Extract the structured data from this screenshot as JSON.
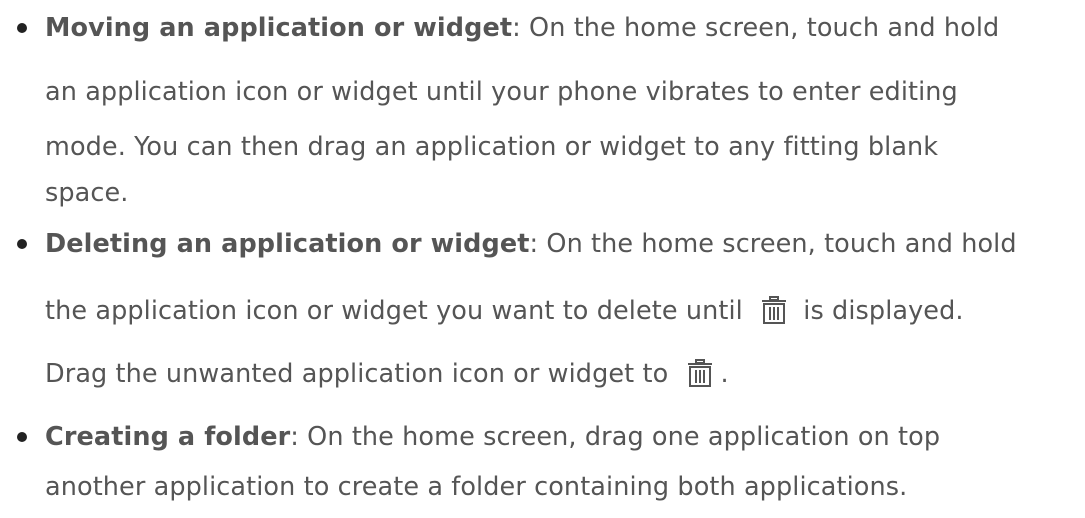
{
  "items": [
    {
      "term": "Moving an application or widget",
      "line1_rest": ": On the home screen, touch and hold",
      "line2": "an application icon or widget until your phone vibrates to enter editing",
      "line3": "mode. You can then drag an application or widget to any fitting blank",
      "line4": "space."
    },
    {
      "term": "Deleting an application or widget",
      "line1_rest": ": On the home screen, touch and hold",
      "line2_before": "the application icon or widget you want to delete until",
      "line2_after": "is displayed.",
      "line3_before": "Drag the unwanted application icon or widget to",
      "line3_after": ".",
      "icon": "trash-icon"
    },
    {
      "term": "Creating a folder",
      "line1_rest": ": On the home screen, drag one application on top",
      "line2": "another application to create a folder containing both applications."
    }
  ],
  "colors": {
    "text": "#555555",
    "bullet": "#222222",
    "icon": "#555555"
  }
}
